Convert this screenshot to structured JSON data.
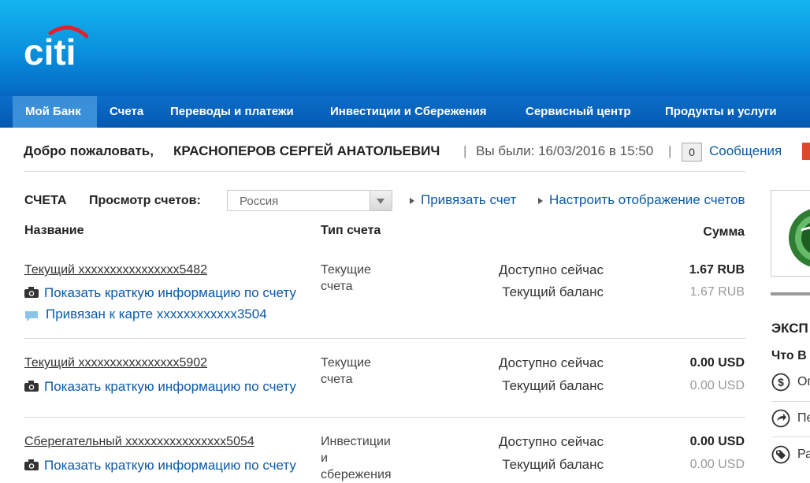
{
  "brand": {
    "logo_text": "citi",
    "colors": {
      "header": "#0a8fdc",
      "nav": "#0558b0",
      "active_tab": "#3a8fd8",
      "link": "#0b5aa8"
    }
  },
  "nav": [
    {
      "label": "Мой Банк",
      "active": true
    },
    {
      "label": "Счета"
    },
    {
      "label": "Переводы и платежи"
    },
    {
      "label": "Инвестиции и Сбережения"
    },
    {
      "label": "Сервисный центр"
    },
    {
      "label": "Продукты и услуги"
    }
  ],
  "welcome": {
    "greeting": "Добро пожаловать,",
    "user": "КРАСНОПЕРОВ СЕРГЕЙ АНАТОЛЬЕВИЧ",
    "last_visit": "Вы были: 16/03/2016 в 15:50",
    "separator": "|",
    "messages_count": "0",
    "messages_label": "Сообщения"
  },
  "accounts": {
    "title": "СЧЕТА",
    "view_label": "Просмотр счетов:",
    "region_select": "Россия",
    "link_account": "Привязать счет",
    "configure_display": "Настроить отображение счетов",
    "columns": {
      "name": "Название",
      "type": "Тип счета",
      "amount": "Сумма"
    },
    "rows": [
      {
        "name": "Текущий xxxxxxxxxxxxxxxx5482",
        "info": "Показать краткую информацию по счету",
        "card": "Привязан к карте xxxxxxxxxxxx3504",
        "type_lines": [
          "Текущие",
          "счета"
        ],
        "available_label": "Доступно сейчас",
        "balance_label": "Текущий баланс",
        "available": "1.67 RUB",
        "balance": "1.67 RUB"
      },
      {
        "name": "Текущий xxxxxxxxxxxxxxxx5902",
        "info": "Показать краткую информацию по счету",
        "type_lines": [
          "Текущие",
          "счета"
        ],
        "available_label": "Доступно сейчас",
        "balance_label": "Текущий баланс",
        "available": "0.00 USD",
        "balance": "0.00 USD"
      },
      {
        "name": "Сберегательный xxxxxxxxxxxxxxxx5054",
        "info": "Показать краткую информацию по счету",
        "type_lines": [
          "Инвестиции",
          "и",
          "сбережения"
        ],
        "available_label": "Доступно сейчас",
        "balance_label": "Текущий баланс",
        "available": "0.00 USD",
        "balance": "0.00 USD"
      }
    ]
  },
  "side": {
    "title": "ЭКСП",
    "subtitle": "Что В",
    "items": [
      {
        "icon": "dollar-circle-icon",
        "text": "Оп"
      },
      {
        "icon": "arrow-circle-icon",
        "text": "Пе"
      },
      {
        "icon": "tag-circle-icon",
        "text": "Ра"
      }
    ]
  }
}
